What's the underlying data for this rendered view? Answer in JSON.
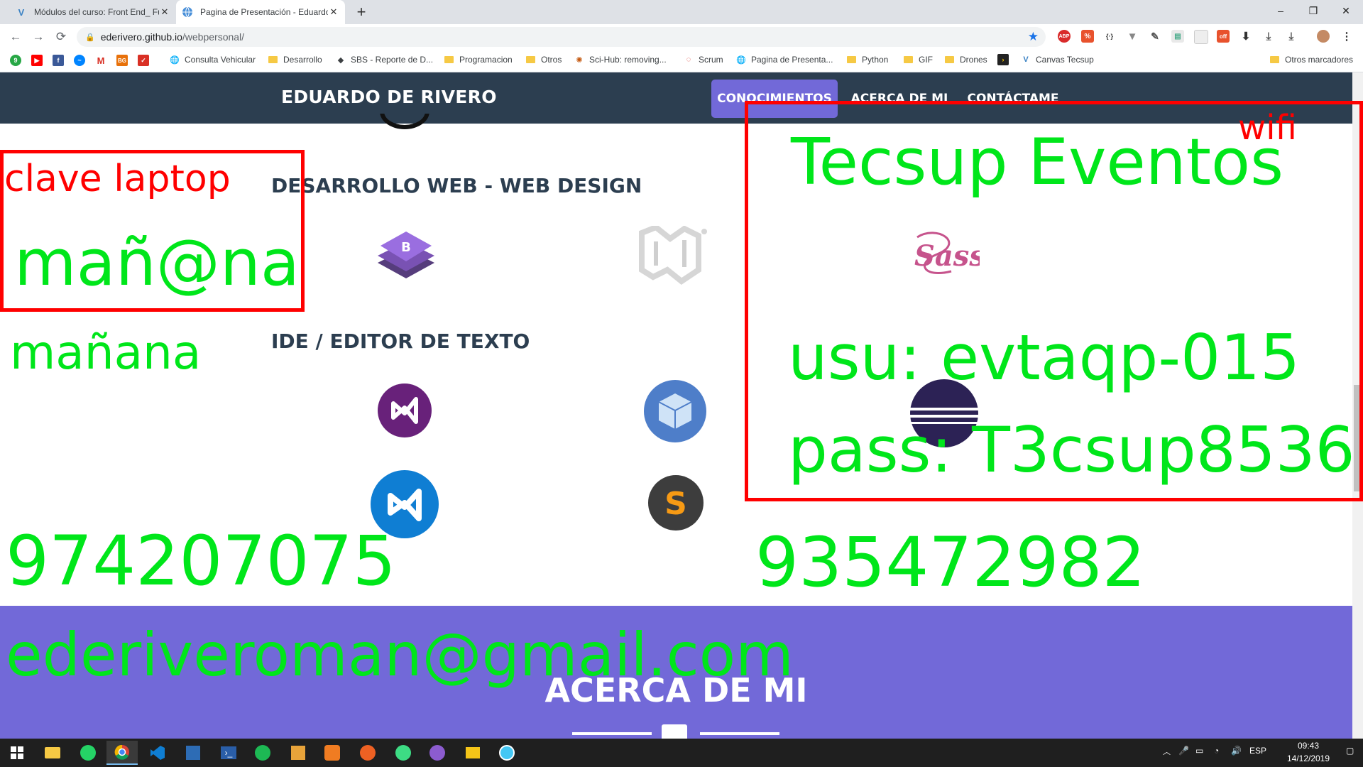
{
  "browser": {
    "tabs": [
      {
        "title": "Módulos del curso: Front End_ Fu",
        "favicon": "V"
      },
      {
        "title": "Pagina de Presentación - Eduardo",
        "favicon": "globe",
        "active": true
      }
    ],
    "new_tab": "+",
    "window_controls": {
      "minimize": "–",
      "maximize": "❐",
      "close": "✕"
    },
    "url": {
      "host": "ederivero.github.io",
      "path": "/webpersonal/"
    },
    "bookmarks": [
      {
        "label": "Consulta Vehicular",
        "icon": "globe"
      },
      {
        "label": "Desarrollo",
        "icon": "folder"
      },
      {
        "label": "SBS - Reporte de D...",
        "icon": "sbs"
      },
      {
        "label": "Programacion",
        "icon": "folder"
      },
      {
        "label": "Otros",
        "icon": "folder"
      },
      {
        "label": "Sci-Hub: removing...",
        "icon": "scihub"
      },
      {
        "label": "Scrum",
        "icon": "scrum"
      },
      {
        "label": "Pagina de Presenta...",
        "icon": "globe"
      },
      {
        "label": "Python",
        "icon": "folder"
      },
      {
        "label": "GIF",
        "icon": "folder"
      },
      {
        "label": "Drones",
        "icon": "folder"
      },
      {
        "label": "Canvas Tecsup",
        "icon": "canvas"
      }
    ],
    "other_bookmarks": "Otros marcadores"
  },
  "site": {
    "brand": "EDUARDO DE RIVERO",
    "nav": [
      "CONOCIMIENTOS",
      "ACERCA DE MI",
      "CONTÁCTAME"
    ],
    "sections": {
      "web_design": "DESARROLLO WEB - WEB DESIGN",
      "ide": "IDE / EDITOR DE TEXTO"
    },
    "about_title": "ACERCA DE MI",
    "icon_names": [
      "bootstrap-icon",
      "materialize-icon",
      "sass-icon",
      "visual-studio-icon",
      "box-icon",
      "eclipse-icon",
      "vscode-icon",
      "sublime-icon"
    ]
  },
  "annotations": {
    "clave_laptop": "clave laptop",
    "password_1": "mañ@na",
    "password_2": "mañana",
    "wifi": "wifi",
    "network": "Tecsup Eventos",
    "user": "usu: evtaqp-015",
    "pass": "pass: T3csup8536",
    "phone_1": "974207075",
    "phone_2": "935472982",
    "email": "ederiveroman@gmail.com",
    "color": "#00e61a",
    "box_color": "#ff0000"
  },
  "taskbar": {
    "language": "ESP",
    "time": "09:43",
    "date": "14/12/2019"
  }
}
